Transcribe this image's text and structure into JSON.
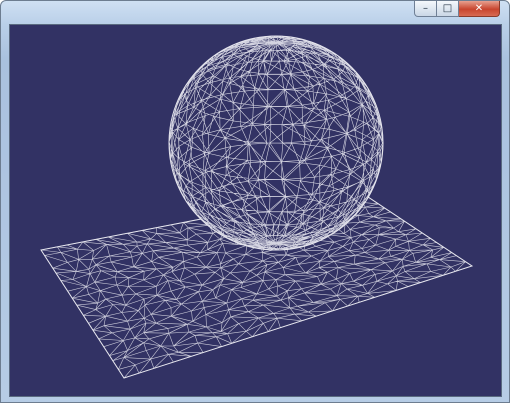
{
  "window": {
    "title": "",
    "buttons": {
      "minimize": "–",
      "maximize": "□",
      "close": "✕"
    }
  },
  "viewport": {
    "background": "#323264",
    "wire_color": "#e6e6ee",
    "objects": [
      "wireframe-sphere",
      "wireframe-plane"
    ]
  }
}
